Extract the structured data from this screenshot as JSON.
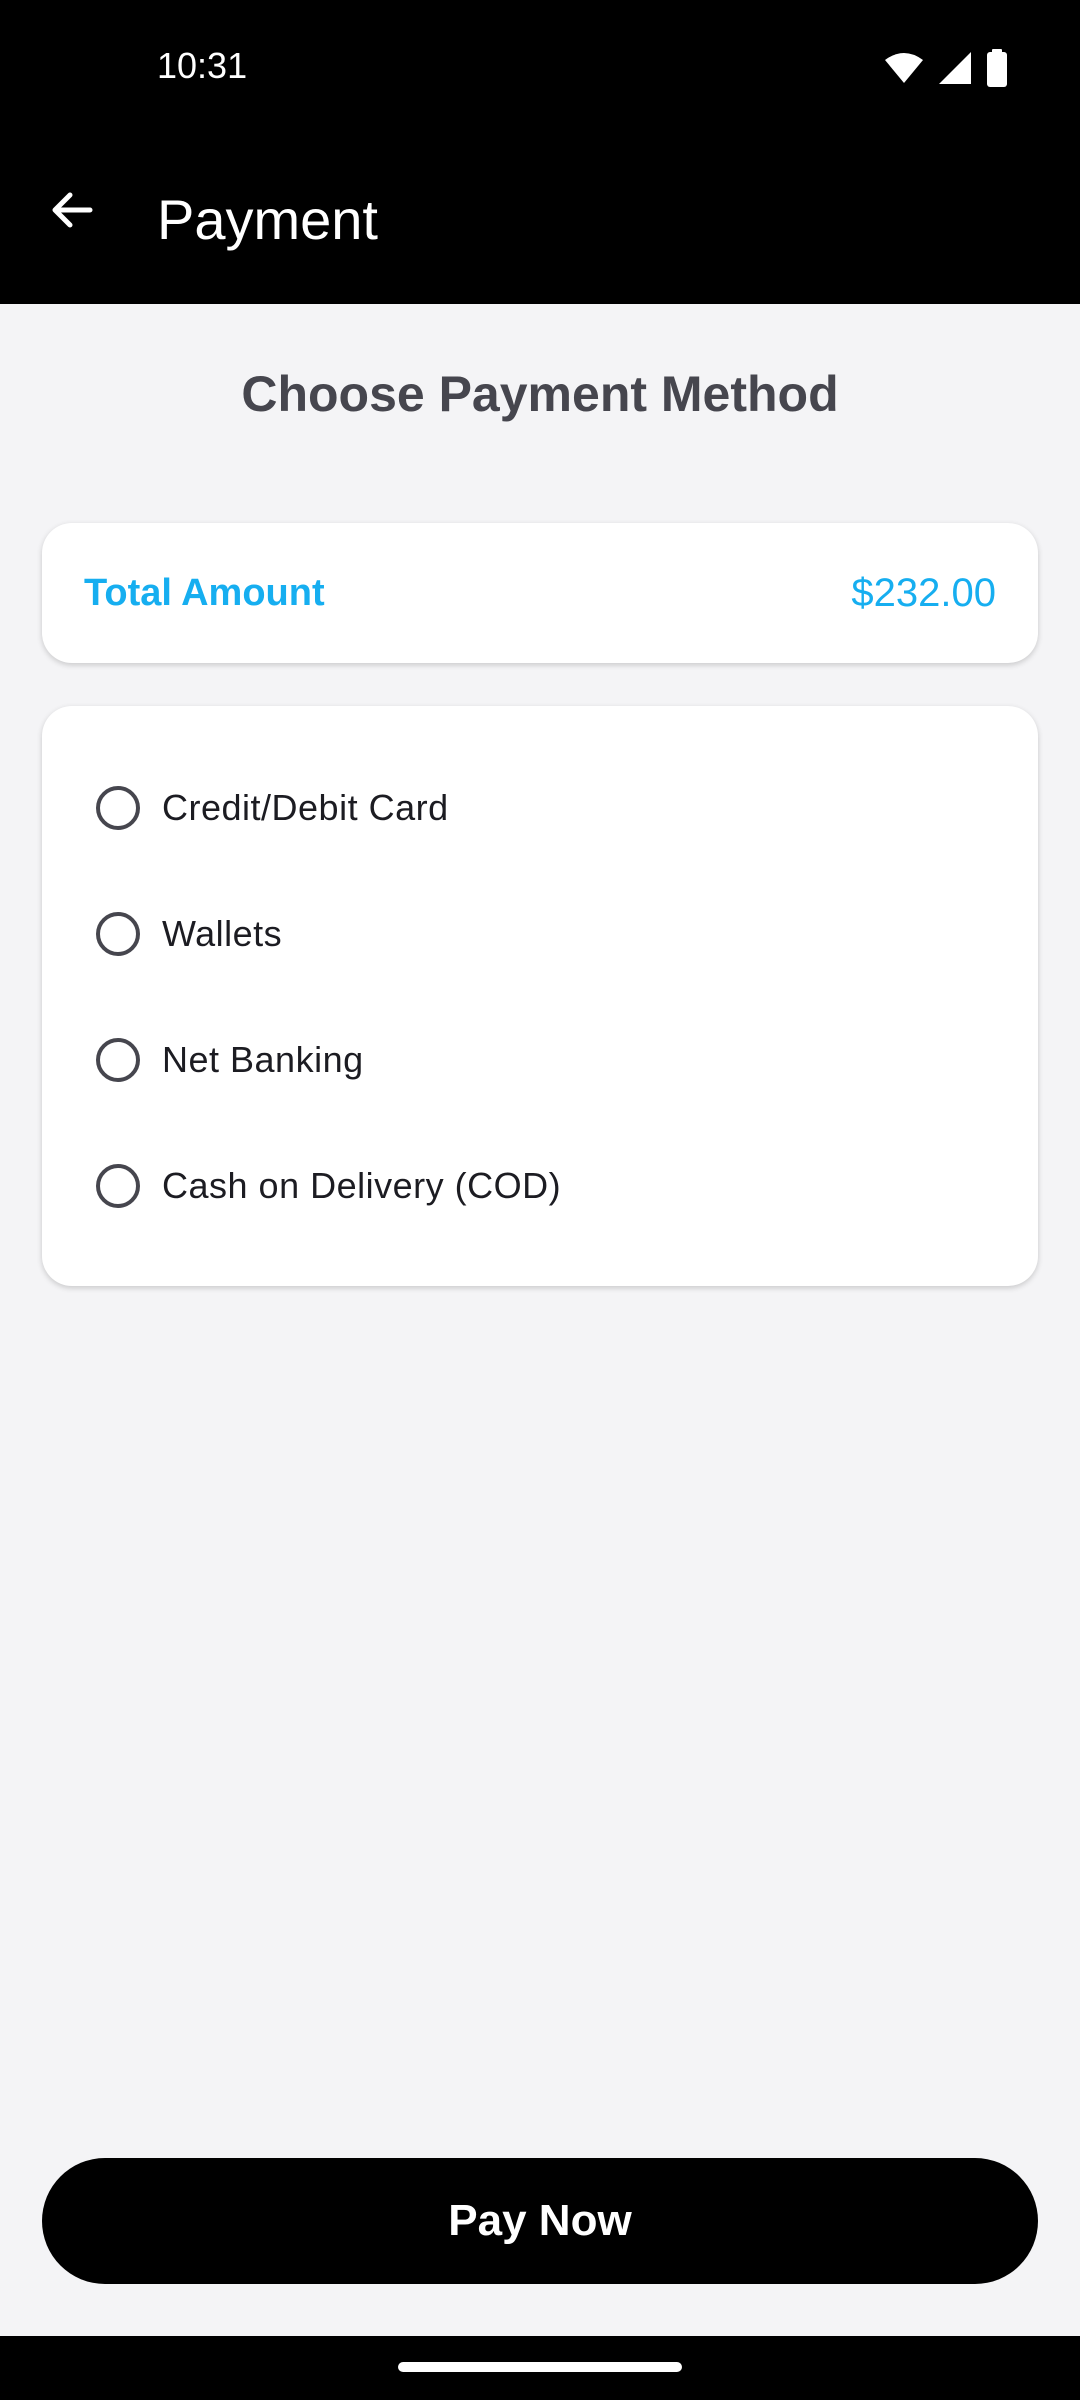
{
  "status_bar": {
    "time": "10:31",
    "icons": [
      "wifi-icon",
      "signal-icon",
      "battery-icon"
    ]
  },
  "app_bar": {
    "back_icon": "arrow-back-icon",
    "title": "Payment"
  },
  "page": {
    "heading": "Choose Payment Method"
  },
  "total": {
    "label": "Total Amount",
    "value": "$232.00"
  },
  "payment_methods": [
    {
      "label": "Credit/Debit Card",
      "selected": false
    },
    {
      "label": "Wallets",
      "selected": false
    },
    {
      "label": "Net Banking",
      "selected": false
    },
    {
      "label": "Cash on Delivery (COD)",
      "selected": false
    }
  ],
  "pay_button": {
    "label": "Pay Now"
  },
  "colors": {
    "accent": "#16aef0",
    "bar_background": "#000000",
    "page_background": "#f4f4f6",
    "heading_text": "#46464e"
  }
}
